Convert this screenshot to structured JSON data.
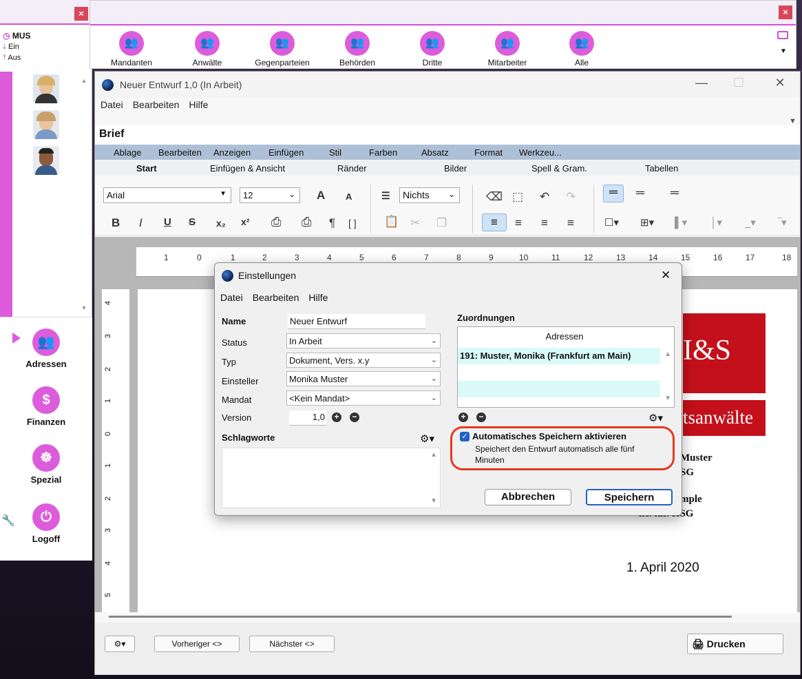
{
  "left_panel": {
    "close": "×",
    "user_code": "MUS",
    "in_label": "Ein",
    "out_label": "Aus",
    "nav": [
      {
        "label": "Adressen",
        "icon": "people-icon"
      },
      {
        "label": "Finanzen",
        "icon": "coins-icon"
      },
      {
        "label": "Spezial",
        "icon": "helm-icon"
      },
      {
        "label": "Logoff",
        "icon": "power-icon"
      }
    ]
  },
  "contact_bar": {
    "close": "×",
    "items": [
      {
        "label": "Mandanten"
      },
      {
        "label": "Anwälte"
      },
      {
        "label": "Gegenparteien"
      },
      {
        "label": "Behörden"
      },
      {
        "label": "Dritte"
      },
      {
        "label": "Mitarbeiter"
      },
      {
        "label": "Alle"
      }
    ]
  },
  "main_window": {
    "title": "Neuer Entwurf 1,0 (In Arbeit)",
    "menu": [
      "Datei",
      "Bearbeiten",
      "Hilfe"
    ],
    "doc_tab": "Brief",
    "ribbon_row1": [
      "Ablage",
      "Bearbeiten",
      "Anzeigen",
      "Einfügen",
      "Stil",
      "Farben",
      "Absatz",
      "Format",
      "Werkzeu..."
    ],
    "ribbon_row2": [
      "Start",
      "Einfügen & Ansicht",
      "Ränder",
      "Bilder",
      "Spell & Gram.",
      "Tabellen"
    ],
    "font": "Arial",
    "font_size": "12",
    "list_style": "Nichts",
    "ruler_numbers": [
      "1",
      "0",
      "1",
      "2",
      "3",
      "4",
      "5",
      "6",
      "7",
      "8",
      "9",
      "10",
      "11",
      "12",
      "13",
      "14",
      "15",
      "16",
      "17",
      "18"
    ],
    "vruler_numbers": [
      "4",
      "3",
      "2",
      "1",
      "0",
      "1",
      "2",
      "3",
      "4",
      "5"
    ],
    "doc": {
      "logo_text": "I&S",
      "logo_sub": "tsanwälte",
      "line1": "Muster",
      "line2": "SG",
      "line3": "mple",
      "line4": "ne. iur. HSG",
      "date": "1. April 2020"
    },
    "bottom": {
      "prev": "Vorheriger <>",
      "next": "Nächster <>",
      "print": "Drucken"
    }
  },
  "dialog": {
    "title": "Einstellungen",
    "menu": [
      "Datei",
      "Bearbeiten",
      "Hilfe"
    ],
    "name_label": "Name",
    "name_value": "Neuer Entwurf",
    "status_label": "Status",
    "status_value": "In Arbeit",
    "typ_label": "Typ",
    "typ_value": "Dokument, Vers. x.y",
    "einsteller_label": "Einsteller",
    "einsteller_value": "Monika Muster",
    "mandat_label": "Mandat",
    "mandat_value": "<Kein Mandat>",
    "version_label": "Version",
    "version_value": "1,0",
    "schlagworte_label": "Schlagworte",
    "zuordnungen_label": "Zuordnungen",
    "adressen_header": "Adressen",
    "adressen_rows": [
      "191: Muster, Monika (Frankfurt am Main)"
    ],
    "autosave_label": "Automatisches Speichern aktivieren",
    "autosave_checked": true,
    "autosave_desc": "Speichert den Entwurf automatisch alle fünf Minuten",
    "cancel": "Abbrechen",
    "save": "Speichern"
  },
  "colors": {
    "accent": "#dc5cdc",
    "highlight": "#e8361f",
    "logo_red": "#c4101b"
  }
}
